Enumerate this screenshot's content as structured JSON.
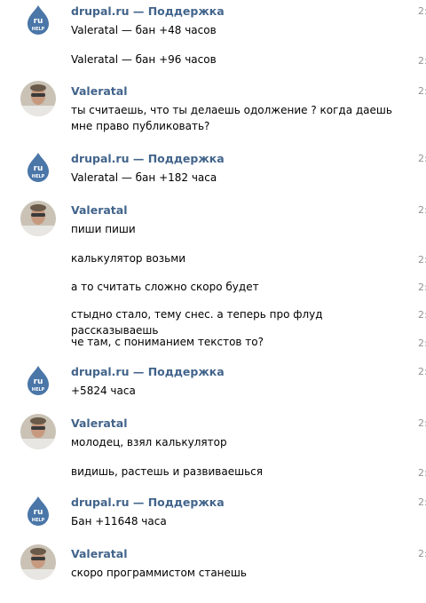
{
  "groups": [
    {
      "author": "drupal.ru — Поддержка",
      "avatar": "drupal-help-drop-icon",
      "messages": [
        {
          "text": "Valeratal — бан +48 часов",
          "time": "2:"
        },
        {
          "text": "Valeratal — бан +96 часов",
          "time": "2:"
        }
      ]
    },
    {
      "author": "Valeratal",
      "avatar": "user-photo",
      "messages": [
        {
          "text": "ты считаешь, что ты делаешь одолжение ? когда даешь мне право публиковать?",
          "time": "2:"
        }
      ]
    },
    {
      "author": "drupal.ru — Поддержка",
      "avatar": "drupal-help-drop-icon",
      "messages": [
        {
          "text": "Valeratal — бан +182 часа",
          "time": "2:"
        }
      ]
    },
    {
      "author": "Valeratal",
      "avatar": "user-photo",
      "messages": [
        {
          "text": "пиши пиши",
          "time": "2:"
        },
        {
          "text": "калькулятор возьми",
          "time": "2:"
        },
        {
          "text": "а то считать сложно скоро будет",
          "time": "2:"
        },
        {
          "text": "стыдно стало, тему снес. а теперь про флуд рассказываешь",
          "time": "2:"
        },
        {
          "text": "че там, с пониманием текстов то?",
          "time": "2:"
        }
      ]
    },
    {
      "author": "drupal.ru — Поддержка",
      "avatar": "drupal-help-drop-icon",
      "messages": [
        {
          "text": "+5824 часа",
          "time": "2:"
        }
      ]
    },
    {
      "author": "Valeratal",
      "avatar": "user-photo",
      "messages": [
        {
          "text": "молодец, взял калькулятор",
          "time": "2:"
        },
        {
          "text": "видишь, растешь и развиваешься",
          "time": "2:"
        }
      ]
    },
    {
      "author": "drupal.ru — Поддержка",
      "avatar": "drupal-help-drop-icon",
      "messages": [
        {
          "text": "Бан +11648 часа",
          "time": "2:"
        }
      ]
    },
    {
      "author": "Valeratal",
      "avatar": "user-photo",
      "messages": [
        {
          "text": "скоро программистом станешь",
          "time": "2:"
        }
      ]
    }
  ],
  "drop_icon": {
    "line1": "ru",
    "line2": "HELP",
    "color": "#4a76a8"
  },
  "author_color": "#42648b",
  "time_color": "#939393"
}
